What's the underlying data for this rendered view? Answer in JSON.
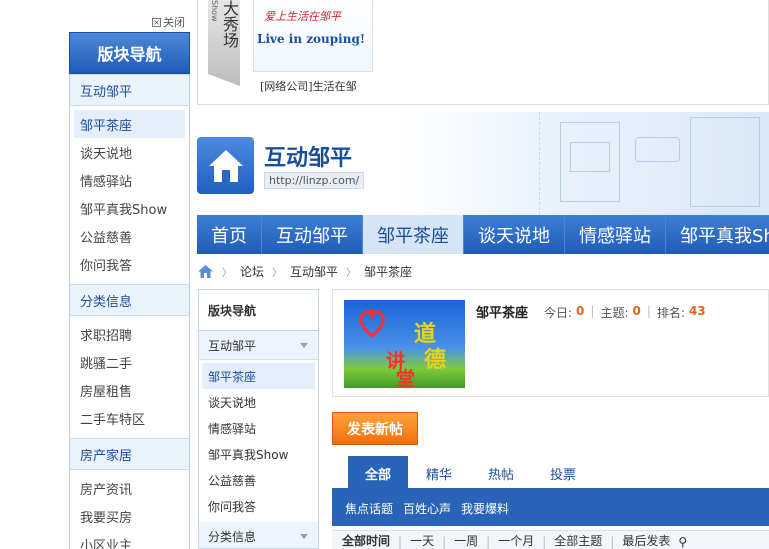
{
  "sidebar": {
    "close_label": "关闭",
    "title": "版块导航",
    "groups": [
      {
        "label": "互动邹平",
        "items": [
          "邹平茶座",
          "谈天说地",
          "情感驿站",
          "邹平真我Show",
          "公益慈善",
          "你问我答"
        ]
      },
      {
        "label": "分类信息",
        "items": [
          "求职招聘",
          "跳骚二手",
          "房屋租售",
          "二手车特区"
        ]
      },
      {
        "label": "房产家居",
        "items": [
          "房产资讯",
          "我要买房",
          "小区业主"
        ]
      }
    ]
  },
  "show": {
    "tag_small": "Show",
    "tag_big": "大秀场",
    "ad_line1": "爱上生活在邹平",
    "ad_line2": "Live in zouping!",
    "ad_caption": "[网络公司]生活在邹"
  },
  "forum": {
    "title": "互动邹平",
    "url": "http://linzp.com/"
  },
  "nav": [
    "首页",
    "互动邹平",
    "邹平茶座",
    "谈天说地",
    "情感驿站",
    "邹平真我Show"
  ],
  "breadcrumb": [
    "论坛",
    "互动邹平",
    "邹平茶座"
  ],
  "inner_sidebar": {
    "title": "版块导航",
    "cat1": "互动邹平",
    "items": [
      "邹平茶座",
      "谈天说地",
      "情感驿站",
      "邹平真我Show",
      "公益慈善",
      "你问我答"
    ],
    "cat2": "分类信息"
  },
  "board": {
    "name": "邹平茶座",
    "image_chars": [
      "道",
      "德",
      "讲",
      "堂"
    ],
    "today_label": "今日:",
    "today": "0",
    "topics_label": "主题:",
    "topics": "0",
    "rank_label": "排名:",
    "rank": "43"
  },
  "post_button": "发表新帖",
  "tabs": [
    "全部",
    "精华",
    "热帖",
    "投票"
  ],
  "subnav": [
    "焦点话题",
    "百姓心声",
    "我要爆料"
  ],
  "filter": [
    "全部时间",
    "一天",
    "一周",
    "一个月",
    "全部主题",
    "最后发表"
  ]
}
